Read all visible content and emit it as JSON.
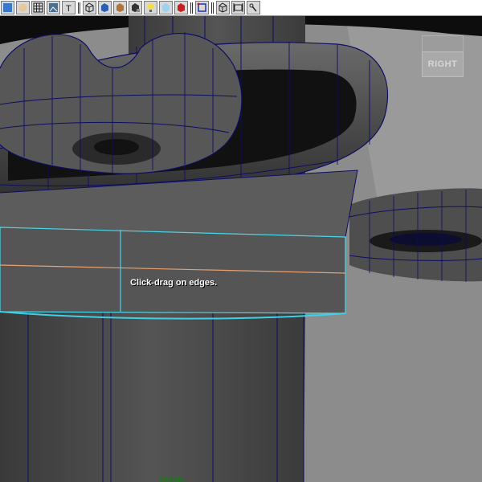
{
  "toolbar": {
    "items": [
      {
        "icon": "select-tool-icon",
        "kind": "button"
      },
      {
        "icon": "paint-tool-icon",
        "kind": "button"
      },
      {
        "icon": "grid-icon",
        "kind": "button"
      },
      {
        "icon": "image-plane-icon",
        "kind": "button"
      },
      {
        "icon": "text-icon",
        "kind": "button"
      },
      {
        "kind": "separator"
      },
      {
        "icon": "wireframe-cube-icon",
        "kind": "button"
      },
      {
        "icon": "smooth-shade-icon",
        "kind": "button"
      },
      {
        "icon": "textured-icon",
        "kind": "button"
      },
      {
        "icon": "shadows-icon",
        "kind": "button"
      },
      {
        "icon": "light-bulb-icon",
        "kind": "button"
      },
      {
        "icon": "xray-icon",
        "kind": "button"
      },
      {
        "icon": "isolate-select-icon",
        "kind": "button"
      },
      {
        "kind": "separator"
      },
      {
        "icon": "frame-selection-icon",
        "kind": "button"
      },
      {
        "kind": "separator"
      },
      {
        "icon": "camera-cube-icon",
        "kind": "button"
      },
      {
        "icon": "resolution-gate-icon",
        "kind": "button"
      },
      {
        "icon": "joint-icon",
        "kind": "button"
      }
    ]
  },
  "viewport": {
    "help_text": "Click-drag on edges.",
    "camera_label": "persp",
    "view_cube_label": "RIGHT",
    "colors": {
      "background": "#8a8a8a",
      "mesh": "#474747",
      "wire": "#0d0d66",
      "selected_edge": "#49d6e8",
      "preselect_edge": "#e8a070",
      "camera_label": "#1a7a1a"
    }
  }
}
